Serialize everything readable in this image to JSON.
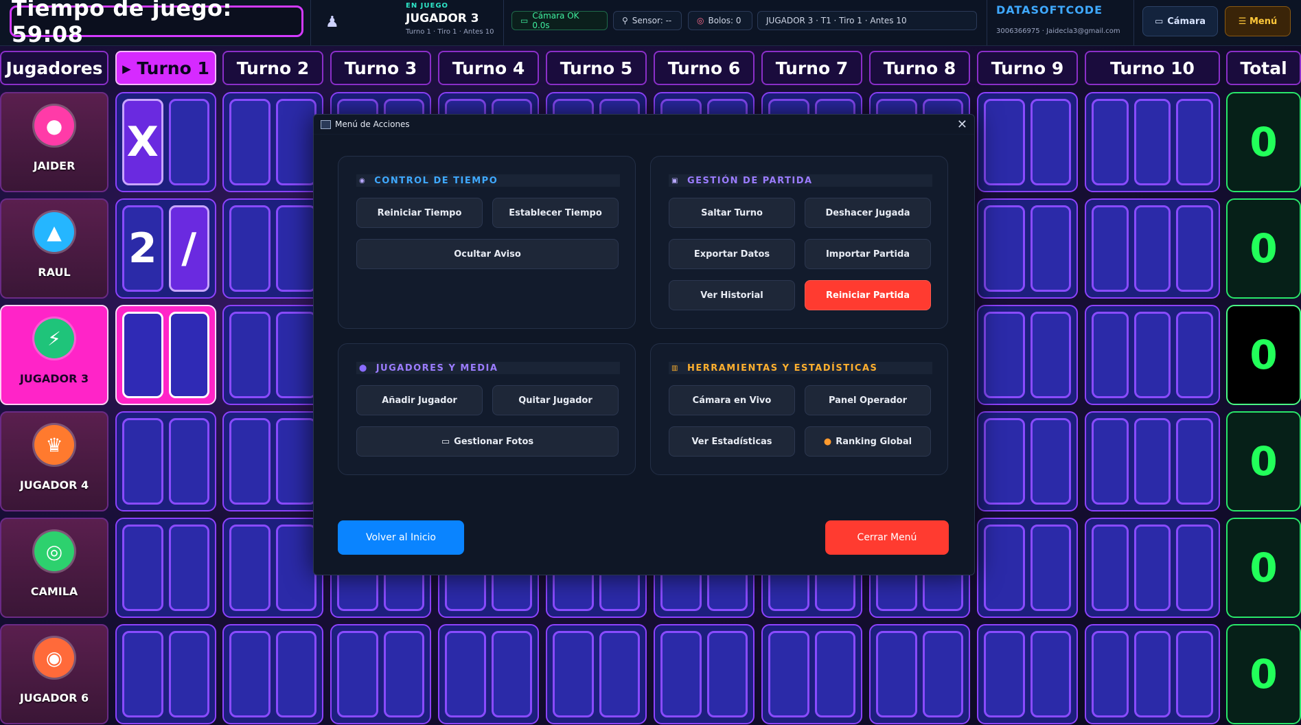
{
  "topbar": {
    "timer_text": "Tiempo de juego: 59:08",
    "pins_icon": "bowling-pins-icon",
    "status_label": "EN JUEGO",
    "current_player": "JUGADOR 3",
    "status_sub": "Turno 1 · Tiro 1 · Antes 10",
    "camera_pill": "Cámara OK  0.0s",
    "sensor_pill": "Sensor: --",
    "pins_pill": "Bolos: 0",
    "info_pill": "JUGADOR 3 · T1 · Tiro 1 · Antes 10",
    "brand_name": "DATASOFTCODE",
    "brand_phone": "3006366975",
    "brand_email": "Jaidecla3@gmail.com",
    "camera_button": "Cámara",
    "menu_button": "☰ Menú"
  },
  "grid": {
    "players_header": "Jugadores",
    "total_header": "Total",
    "turns": [
      "▸ Turno 1",
      "Turno 2",
      "Turno 3",
      "Turno 4",
      "Turno 5",
      "Turno 6",
      "Turno 7",
      "Turno 8",
      "Turno 9",
      "Turno 10"
    ],
    "active_turn": 1,
    "players": [
      {
        "name": "JAIDER",
        "icon": "bowling-icon",
        "color": "#ff3ba8",
        "total": "0",
        "active": false,
        "f1": [
          "X",
          ""
        ]
      },
      {
        "name": "RAUL",
        "icon": "fire-icon",
        "color": "#25b6ff",
        "total": "0",
        "active": false,
        "f1": [
          "2",
          "/"
        ]
      },
      {
        "name": "JUGADOR 3",
        "icon": "lightning-icon",
        "color": "#1fc47a",
        "total": "0",
        "active": true,
        "f1": [
          "",
          ""
        ]
      },
      {
        "name": "JUGADOR 4",
        "icon": "crown-icon",
        "color": "#ff7a2e",
        "total": "0",
        "active": false,
        "f1": [
          "",
          ""
        ]
      },
      {
        "name": "CAMILA",
        "icon": "target-icon",
        "color": "#2dd16e",
        "total": "0",
        "active": false,
        "f1": [
          "",
          ""
        ]
      },
      {
        "name": "JUGADOR 6",
        "icon": "alien-icon",
        "color": "#ff6a3a",
        "total": "0",
        "active": false,
        "f1": [
          "",
          ""
        ]
      }
    ]
  },
  "modal": {
    "window_title": "Menú de Acciones",
    "sections": {
      "time": {
        "title": "CONTROL DE TIEMPO",
        "color": "#3fa9ff",
        "buttons": [
          "Reiniciar Tiempo",
          "Establecer Tiempo",
          "Ocultar Aviso"
        ]
      },
      "game": {
        "title": "GESTIÓN DE PARTIDA",
        "color": "#9b7cff",
        "buttons": [
          "Saltar Turno",
          "Deshacer Jugada",
          "Exportar Datos",
          "Importar Partida",
          "Ver Historial",
          "Reiniciar Partida"
        ]
      },
      "players": {
        "title": "JUGADORES Y MEDIA",
        "color": "#9b7cff",
        "buttons": [
          "Añadir Jugador",
          "Quitar Jugador",
          "Gestionar Fotos"
        ]
      },
      "tools": {
        "title": "HERRAMIENTAS Y ESTADÍSTICAS",
        "color": "#ffb02e",
        "buttons": [
          "Cámara en Vivo",
          "Panel Operador",
          "Ver Estadísticas",
          "Ranking Global"
        ]
      }
    },
    "home_button": "Volver al Inicio",
    "close_button": "Cerrar Menú"
  }
}
